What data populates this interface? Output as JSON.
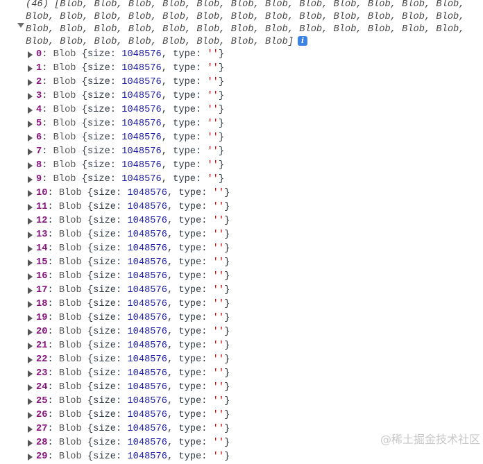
{
  "console": {
    "array_summary_lines": [
      "(46) [Blob, Blob, Blob, Blob, Blob, Blob, Blob, Blob, Blob, Blob, Blob, Blob,",
      "Blob, Blob, Blob, Blob, Blob, Blob, Blob, Blob, Blob, Blob, Blob, Blob, Blob,",
      "Blob, Blob, Blob, Blob, Blob, Blob, Blob, Blob, Blob, Blob, Blob, Blob, Blob,",
      "Blob, Blob, Blob, Blob, Blob, Blob, Blob, Blob]"
    ],
    "info_icon": "i",
    "items": [
      {
        "index": "0",
        "class": "Blob",
        "size": "1048576",
        "type": "''"
      },
      {
        "index": "1",
        "class": "Blob",
        "size": "1048576",
        "type": "''"
      },
      {
        "index": "2",
        "class": "Blob",
        "size": "1048576",
        "type": "''"
      },
      {
        "index": "3",
        "class": "Blob",
        "size": "1048576",
        "type": "''"
      },
      {
        "index": "4",
        "class": "Blob",
        "size": "1048576",
        "type": "''"
      },
      {
        "index": "5",
        "class": "Blob",
        "size": "1048576",
        "type": "''"
      },
      {
        "index": "6",
        "class": "Blob",
        "size": "1048576",
        "type": "''"
      },
      {
        "index": "7",
        "class": "Blob",
        "size": "1048576",
        "type": "''"
      },
      {
        "index": "8",
        "class": "Blob",
        "size": "1048576",
        "type": "''"
      },
      {
        "index": "9",
        "class": "Blob",
        "size": "1048576",
        "type": "''"
      },
      {
        "index": "10",
        "class": "Blob",
        "size": "1048576",
        "type": "''"
      },
      {
        "index": "11",
        "class": "Blob",
        "size": "1048576",
        "type": "''"
      },
      {
        "index": "12",
        "class": "Blob",
        "size": "1048576",
        "type": "''"
      },
      {
        "index": "13",
        "class": "Blob",
        "size": "1048576",
        "type": "''"
      },
      {
        "index": "14",
        "class": "Blob",
        "size": "1048576",
        "type": "''"
      },
      {
        "index": "15",
        "class": "Blob",
        "size": "1048576",
        "type": "''"
      },
      {
        "index": "16",
        "class": "Blob",
        "size": "1048576",
        "type": "''"
      },
      {
        "index": "17",
        "class": "Blob",
        "size": "1048576",
        "type": "''"
      },
      {
        "index": "18",
        "class": "Blob",
        "size": "1048576",
        "type": "''"
      },
      {
        "index": "19",
        "class": "Blob",
        "size": "1048576",
        "type": "''"
      },
      {
        "index": "20",
        "class": "Blob",
        "size": "1048576",
        "type": "''"
      },
      {
        "index": "21",
        "class": "Blob",
        "size": "1048576",
        "type": "''"
      },
      {
        "index": "22",
        "class": "Blob",
        "size": "1048576",
        "type": "''"
      },
      {
        "index": "23",
        "class": "Blob",
        "size": "1048576",
        "type": "''"
      },
      {
        "index": "24",
        "class": "Blob",
        "size": "1048576",
        "type": "''"
      },
      {
        "index": "25",
        "class": "Blob",
        "size": "1048576",
        "type": "''"
      },
      {
        "index": "26",
        "class": "Blob",
        "size": "1048576",
        "type": "''"
      },
      {
        "index": "27",
        "class": "Blob",
        "size": "1048576",
        "type": "''"
      },
      {
        "index": "28",
        "class": "Blob",
        "size": "1048576",
        "type": "''"
      },
      {
        "index": "29",
        "class": "Blob",
        "size": "1048576",
        "type": "''"
      }
    ]
  },
  "watermark": "@稀土掘金技术社区"
}
